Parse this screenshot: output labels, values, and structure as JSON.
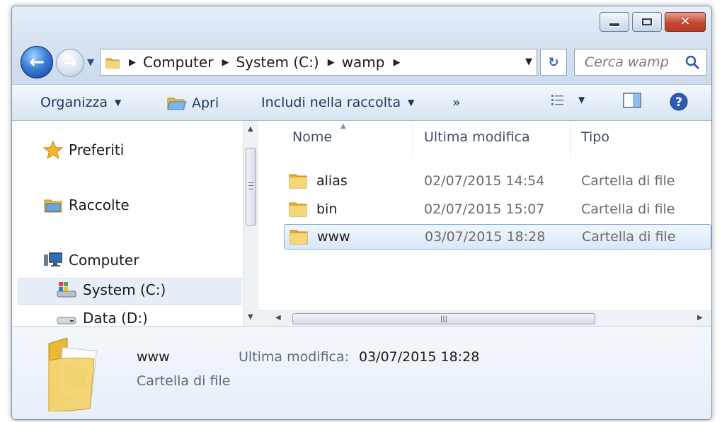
{
  "window": {
    "controls": {
      "minimize": "minimize",
      "maximize": "maximize",
      "close": "close"
    }
  },
  "navigation": {
    "breadcrumb": [
      "Computer",
      "System (C:)",
      "wamp"
    ],
    "search_placeholder": "Cerca wamp"
  },
  "toolbar": {
    "organize": "Organizza",
    "open": "Apri",
    "include": "Includi nella raccolta",
    "more": "»"
  },
  "sidebar": {
    "items": [
      {
        "label": "Preferiti",
        "icon": "star-icon"
      },
      {
        "label": "Raccolte",
        "icon": "libraries-icon"
      },
      {
        "label": "Computer",
        "icon": "computer-icon"
      },
      {
        "label": "System (C:)",
        "icon": "system-drive-icon",
        "selected": true
      },
      {
        "label": "Data (D:)",
        "icon": "drive-icon"
      }
    ]
  },
  "file_list": {
    "columns": [
      "Nome",
      "Ultima modifica",
      "Tipo"
    ],
    "rows": [
      {
        "name": "alias",
        "modified": "02/07/2015 14:54",
        "type": "Cartella di file"
      },
      {
        "name": "bin",
        "modified": "02/07/2015 15:07",
        "type": "Cartella di file"
      },
      {
        "name": "www",
        "modified": "03/07/2015 18:28",
        "type": "Cartella di file",
        "selected": true
      }
    ]
  },
  "details": {
    "name": "www",
    "modified_label": "Ultima modifica:",
    "modified_value": "03/07/2015 18:28",
    "type": "Cartella di file"
  },
  "colors": {
    "accent": "#3c7fd6",
    "selection": "#d9e8f9",
    "close_button": "#c4472f",
    "folder": "#f2c94c"
  }
}
